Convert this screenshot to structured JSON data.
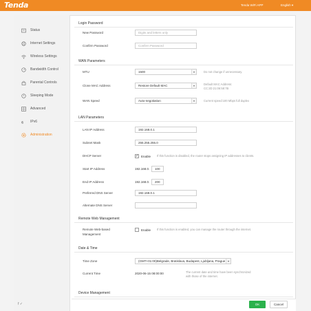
{
  "header": {
    "logo": "Tenda",
    "app_link": "Tenda WiFi APP",
    "language": "English ▾"
  },
  "colors": {
    "accent": "#f08a24",
    "ok_button": "#2bb24c"
  },
  "sidebar": {
    "items": [
      {
        "label": "Status",
        "icon": "status-icon"
      },
      {
        "label": "Internet Settings",
        "icon": "globe-icon"
      },
      {
        "label": "Wireless Settings",
        "icon": "wifi-icon"
      },
      {
        "label": "Bandwidth Control",
        "icon": "gauge-icon"
      },
      {
        "label": "Parental Controls",
        "icon": "lock-icon"
      },
      {
        "label": "Sleeping Mode",
        "icon": "power-icon"
      },
      {
        "label": "Advanced",
        "icon": "grid-icon"
      },
      {
        "label": "IPv6",
        "icon": "ipv6-icon"
      },
      {
        "label": "Administration",
        "icon": "gear-icon",
        "active": true
      }
    ],
    "social": "f  ✓"
  },
  "login": {
    "title": "Login Password",
    "new_label": "New Password",
    "new_placeholder": "Digits and letters only",
    "confirm_label": "Confirm Password",
    "confirm_placeholder": "Confirm Password"
  },
  "wan": {
    "title": "WAN Parameters",
    "mtu_label": "MTU",
    "mtu_value": "1500",
    "mtu_hint": "Do not change if unnecessary.",
    "clone_label": "Clone MAC Address",
    "clone_value": "Restore Default MAC",
    "clone_hint_1": "Default MAC Address:",
    "clone_hint_2": "CC:2D:21:06:58:7B",
    "speed_label": "WAN Speed",
    "speed_value": "Auto-negotiation",
    "speed_hint": "Current speed:100 Mbps full duplex"
  },
  "lan": {
    "title": "LAN Parameters",
    "ip_label": "LAN IP Address",
    "ip_value": "192.168.0.1",
    "mask_label": "Subnet Mask",
    "mask_value": "255.255.255.0",
    "dhcp_label": "DHCP Server",
    "dhcp_check": "Enable",
    "dhcp_hint": "If this function is disabled, the router stops assigning IP addresses to clients.",
    "start_label": "Start IP Address",
    "start_prefix": "192.168.0.",
    "start_value": "100",
    "end_label": "End IP Address",
    "end_prefix": "192.168.0.",
    "end_value": "200",
    "dns1_label": "Preferred DNS Server",
    "dns1_value": "192.168.0.1",
    "dns2_label": "Alternate DNS Server",
    "dns2_value": ""
  },
  "remote": {
    "title": "Remote Web Management",
    "label_1": "Remote Web-based",
    "label_2": "Management",
    "check": "Enable",
    "hint": "If this function is enabled, you can manage the router through the internet."
  },
  "datetime": {
    "title": "Date & Time",
    "zone_label": "Time Zone",
    "zone_value": "(GMT+01:00)Belgrade, Bratislava, Budapest, Ljubljana, Prague",
    "time_label": "Current Time",
    "time_value": "2020-06-15 08:00:00",
    "time_hint_1": "The current date and time have been synchronized",
    "time_hint_2": "with those of the internet."
  },
  "device": {
    "title": "Device Management"
  },
  "buttons": {
    "ok": "OK",
    "cancel": "Cancel"
  }
}
